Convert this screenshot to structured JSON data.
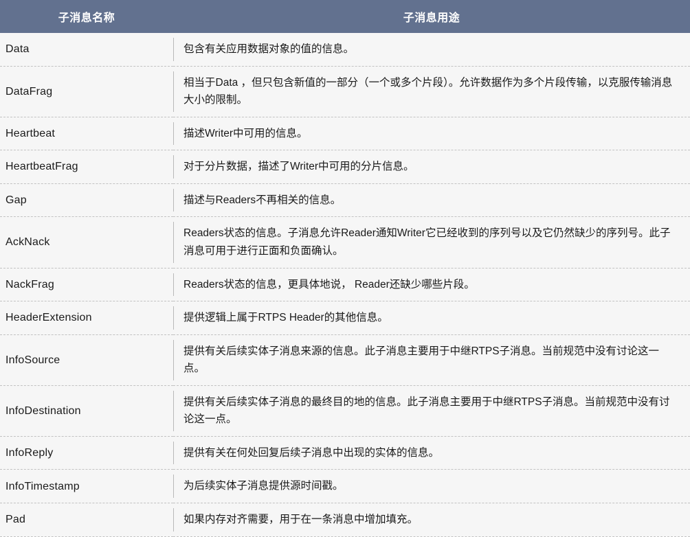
{
  "table": {
    "headers": {
      "name": "子消息名称",
      "usage": "子消息用途"
    },
    "header_bg": "#62718f",
    "header_text_color": "#ffffff",
    "row_bg": "#f6f6f6",
    "divider_color": "#c2c2c2",
    "rows": [
      {
        "name": "Data",
        "usage": "包含有关应用数据对象的值的信息。"
      },
      {
        "name": "DataFrag",
        "usage": "相当于Data ，但只包含新值的一部分（一个或多个片段）。允许数据作为多个片段传输，以克服传输消息大小的限制。"
      },
      {
        "name": "Heartbeat",
        "usage": "描述Writer中可用的信息。"
      },
      {
        "name": "HeartbeatFrag",
        "usage": "对于分片数据，描述了Writer中可用的分片信息。"
      },
      {
        "name": "Gap",
        "usage": "描述与Readers不再相关的信息。"
      },
      {
        "name": "AckNack",
        "usage": "Readers状态的信息。子消息允许Reader通知Writer它已经收到的序列号以及它仍然缺少的序列号。此子消息可用于进行正面和负面确认。"
      },
      {
        "name": "NackFrag",
        "usage": "Readers状态的信息，更具体地说， Reader还缺少哪些片段。"
      },
      {
        "name": "HeaderExtension",
        "usage": "提供逻辑上属于RTPS Header的其他信息。"
      },
      {
        "name": "InfoSource",
        "usage": "提供有关后续实体子消息来源的信息。此子消息主要用于中继RTPS子消息。当前规范中没有讨论这一点。"
      },
      {
        "name": "InfoDestination",
        "usage": "提供有关后续实体子消息的最终目的地的信息。此子消息主要用于中继RTPS子消息。当前规范中没有讨论这一点。"
      },
      {
        "name": "InfoReply",
        "usage": "提供有关在何处回复后续子消息中出现的实体的信息。"
      },
      {
        "name": "InfoTimestamp",
        "usage": "为后续实体子消息提供源时间戳。"
      },
      {
        "name": "Pad",
        "usage": "如果内存对齐需要，用于在一条消息中增加填充。"
      }
    ]
  }
}
